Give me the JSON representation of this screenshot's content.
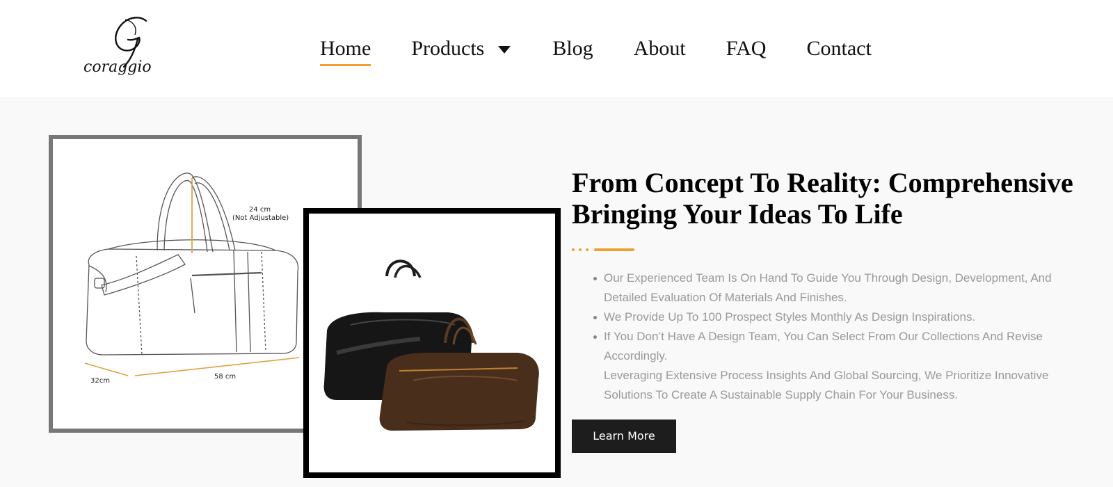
{
  "brand": {
    "logo_text": "coraggio",
    "logo_monogram": "G"
  },
  "nav": {
    "items": [
      {
        "label": "Home",
        "active": true
      },
      {
        "label": "Products",
        "has_dropdown": true
      },
      {
        "label": "Blog"
      },
      {
        "label": "About"
      },
      {
        "label": "FAQ"
      },
      {
        "label": "Contact"
      }
    ]
  },
  "sketch": {
    "height_label": "24 cm",
    "height_note": "(Not Adjustable)",
    "width_label": "58 cm",
    "depth_label": "32cm"
  },
  "content": {
    "heading_line1": "From Concept To Reality: Comprehensive",
    "heading_line2": "Bringing Your Ideas To Life",
    "bullets": [
      "Our Experienced Team Is On Hand To Guide You Through Design, Development, And Detailed Evaluation Of Materials And Finishes.",
      "We Provide Up To 100 Prospect Styles Monthly As Design Inspirations.",
      "If You Don’t Have A Design Team, You Can Select From Our Collections And Revise Accordingly."
    ],
    "paragraph": "Leveraging Extensive Process Insights And Global Sourcing, We Prioritize Innovative Solutions To Create A Sustainable Supply Chain For Your Business.",
    "cta_label": "Learn More"
  },
  "colors": {
    "accent": "#f0a030",
    "button_bg": "#1d1d1d",
    "body_text": "#999999"
  }
}
